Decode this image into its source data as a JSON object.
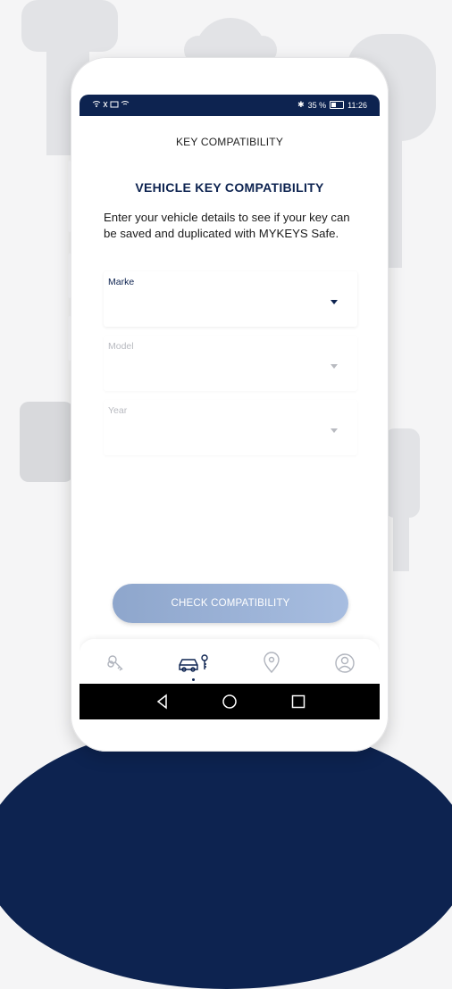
{
  "status_bar": {
    "battery": "35 %",
    "time": "11:26"
  },
  "app": {
    "title": "KEY COMPATIBILITY",
    "heading": "VEHICLE KEY COMPATIBILITY",
    "description": "Enter your vehicle details to see if your key can be saved and duplicated with MYKEYS Safe."
  },
  "form": {
    "make_label": "Marke",
    "model_label": "Model",
    "year_label": "Year",
    "check_button": "CHECK COMPATIBILITY"
  },
  "bottom_nav": {
    "items": [
      {
        "icon": "keys-icon",
        "active": false
      },
      {
        "icon": "car-key-icon",
        "active": true
      },
      {
        "icon": "location-key-icon",
        "active": false
      },
      {
        "icon": "profile-icon",
        "active": false
      }
    ]
  },
  "colors": {
    "primary": "#0d2350",
    "button": "#9bb2d8",
    "background": "#f5f5f6"
  }
}
